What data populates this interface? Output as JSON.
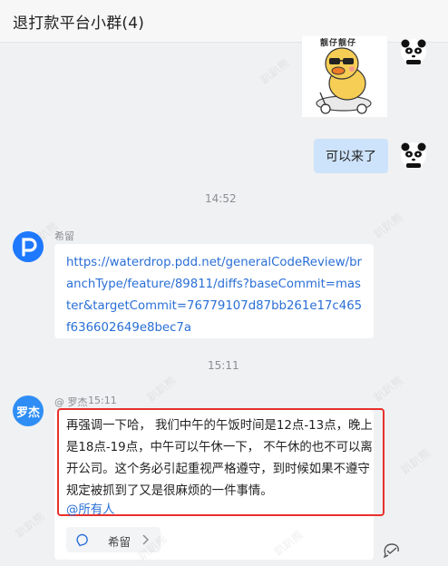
{
  "header": {
    "title": "退打款平台小群(4)"
  },
  "messages": {
    "sticker": {
      "caption": "靓仔靓仔"
    },
    "self_bubble": {
      "text": "可以来了"
    },
    "time1": "14:52",
    "xiliu": {
      "sender": "希留",
      "link": "https://waterdrop.pdd.net/generalCodeReview/branchType/feature/89811/diffs?baseCommit=master&targetCommit=76779107d87bb261e17c465f636602649e8bec7a"
    },
    "time2": "15:11",
    "luojie": {
      "avatar_text": "罗杰",
      "sender": "@ 罗杰",
      "time": "15:11",
      "text": "再强调一下哈， 我们中午的午饭时间是12点-13点，晚上是18点-19点，中午可以午休一下， 不午休的也不可以离开公司。这个务必引起重视严格遵守，到时候如果不遵守规定被抓到了又是很麻烦的一件事情。",
      "mention": "@所有人",
      "reply_label": "希留"
    }
  },
  "watermark": "趴趴熊",
  "colors": {
    "accent": "#2a6fd6",
    "self_bubble": "#cde3fb",
    "highlight": "#e8302c",
    "avatar_blue": "#1f79ff"
  }
}
